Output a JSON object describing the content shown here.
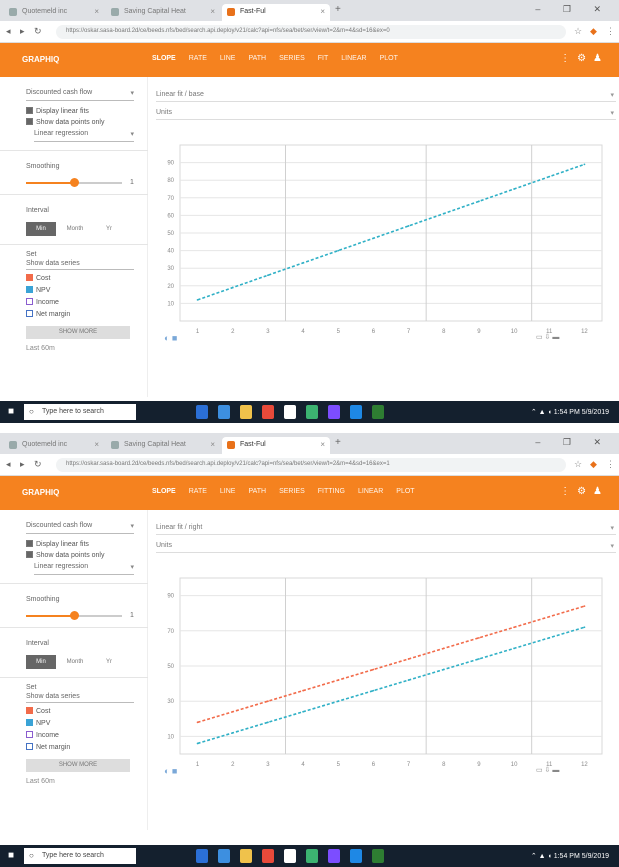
{
  "screenshots": [
    {
      "browser": {
        "tabs": [
          {
            "label": "Quotemeld inc"
          },
          {
            "label": "Saving Capital Heat"
          },
          {
            "label": "Fast-Ful"
          }
        ],
        "url": "https://oskar.sasa-board.2d/ce/beeds.nfs/bed/search.api.deploy/v21/calc?api=nfs/sea/bet/ser/view/t=2&m=4&sd=16&ex=0",
        "window_controls": "–  ❐  ✕"
      },
      "app": {
        "brand": "GRAPHIQ",
        "menu": [
          "SLOPE",
          "RATE",
          "LINE",
          "PATH",
          "SERIES",
          "FIT",
          "LINEAR",
          "PLOT"
        ],
        "selected_menu_index": 0
      },
      "sidebar": {
        "dataset_select": "Discounted cash flow",
        "checkboxes": [
          "Display linear fits",
          "Show data points only"
        ],
        "model_select": "Linear regression",
        "smoothing_label": "Smoothing",
        "smoothing_value": "1",
        "smoothing_fraction": 0.5,
        "interval_label": "Interval",
        "interval_options": [
          "Min",
          "Month",
          "Yr"
        ],
        "interval_selected": 0,
        "legend_heading": "Set",
        "legend_title": "Show data series",
        "legend_items": [
          {
            "label": "Cost",
            "color": "#f26b4a"
          },
          {
            "label": "NPV",
            "color": "#3aa3d6"
          },
          {
            "label": "Income",
            "color": "#8a5ccf"
          },
          {
            "label": "Net margin",
            "color": "#4472c4"
          }
        ],
        "button_label": "SHOW MORE",
        "footer_text": "Last 60m"
      },
      "main": {
        "field1": "Linear fit / base",
        "field2": "Units"
      },
      "chart_data": {
        "type": "line",
        "title": "",
        "ylabel": "",
        "xlabel": "",
        "x": [
          1,
          2,
          3,
          4,
          5,
          6,
          7,
          8,
          9,
          10,
          11,
          12
        ],
        "xlim": [
          0.5,
          12.5
        ],
        "ylim": [
          0,
          100
        ],
        "yticks": [
          10,
          20,
          30,
          40,
          50,
          60,
          70,
          80,
          90
        ],
        "grid": true,
        "series": [
          {
            "color": "#2fb0c6",
            "values": [
              12,
              19,
              26,
              33,
              40,
              47,
              54,
              61,
              68,
              75,
              82,
              89
            ]
          }
        ],
        "legend": "bottom-right"
      },
      "taskbar": {
        "search_placeholder": "Type here to search",
        "time": "1:54 PM",
        "date": "5/9/2019"
      }
    },
    {
      "browser": {
        "tabs": [
          {
            "label": "Quotemeld inc"
          },
          {
            "label": "Saving Capital Heat"
          },
          {
            "label": "Fast-Ful"
          }
        ],
        "url": "https://oskar.sasa-board.2d/ce/beeds.nfs/bed/search.api.deploy/v21/calc?api=nfs/sea/bet/ser/view/t=2&m=4&sd=16&ex=1",
        "window_controls": "–  ❐  ✕"
      },
      "app": {
        "brand": "GRAPHIQ",
        "menu": [
          "SLOPE",
          "RATE",
          "LINE",
          "PATH",
          "SERIES",
          "FITTING",
          "LINEAR",
          "PLOT"
        ],
        "selected_menu_index": 0
      },
      "sidebar": {
        "dataset_select": "Discounted cash flow",
        "checkboxes": [
          "Display linear fits",
          "Show data points only"
        ],
        "model_select": "Linear regression",
        "smoothing_label": "Smoothing",
        "smoothing_value": "1",
        "smoothing_fraction": 0.5,
        "interval_label": "Interval",
        "interval_options": [
          "Min",
          "Month",
          "Yr"
        ],
        "interval_selected": 0,
        "legend_heading": "Set",
        "legend_title": "Show data series",
        "legend_items": [
          {
            "label": "Cost",
            "color": "#f26b4a"
          },
          {
            "label": "NPV",
            "color": "#3aa3d6"
          },
          {
            "label": "Income",
            "color": "#8a5ccf"
          },
          {
            "label": "Net margin",
            "color": "#4472c4"
          }
        ],
        "button_label": "SHOW MORE",
        "footer_text": "Last 60m"
      },
      "main": {
        "field1": "Linear fit / right",
        "field2": "Units"
      },
      "chart_data": {
        "type": "line",
        "title": "",
        "ylabel": "",
        "xlabel": "",
        "x": [
          1,
          2,
          3,
          4,
          5,
          6,
          7,
          8,
          9,
          10,
          11,
          12
        ],
        "xlim": [
          0.5,
          12.5
        ],
        "ylim": [
          0,
          100
        ],
        "yticks": [
          10,
          30,
          50,
          70,
          90
        ],
        "grid": true,
        "series": [
          {
            "color": "#f26b4a",
            "values": [
              18,
              24,
              30,
              36,
              42,
              48,
              54,
              60,
              66,
              72,
              78,
              84
            ]
          },
          {
            "color": "#2fb0c6",
            "values": [
              6,
              12,
              18,
              24,
              30,
              36,
              42,
              48,
              54,
              60,
              66,
              72
            ]
          }
        ],
        "legend": "bottom-right"
      },
      "taskbar": {
        "search_placeholder": "Type here to search",
        "time": "1:54 PM",
        "date": "5/9/2019"
      }
    }
  ]
}
